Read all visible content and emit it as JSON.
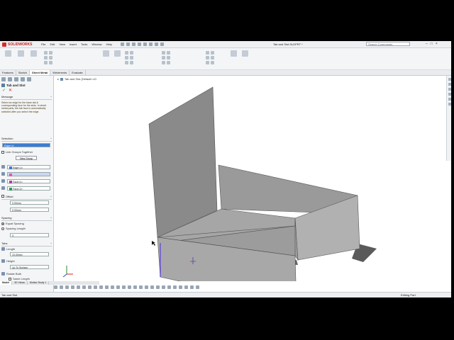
{
  "app": {
    "logo_text": "SOLIDWORKS",
    "document_title": "Tab and Slot.SLDPRT *",
    "search_placeholder": "Search Commands",
    "menus": [
      "File",
      "Edit",
      "View",
      "Insert",
      "Tools",
      "Window",
      "Help"
    ]
  },
  "tabs": [
    "Features",
    "Sketch",
    "Sheet Metal",
    "Weldments",
    "Evaluate"
  ],
  "active_tab": "Sheet Metal",
  "feature_tree_item": "Tab and Slot (Default<<D",
  "panel": {
    "title": "Tab and Slot",
    "message_header": "Message",
    "message_text": "Select an edge for the base tab & corresponding face for the slots. In sheet metal parts, the tab face is automatically selected after you select the edge.",
    "selection_header": "Selection",
    "edge_field": "Edge<1>",
    "link_groups_label": "Link Groups Together",
    "new_group_button": "New Group",
    "sel_items": [
      "Edge<1>",
      "",
      "Face<1>",
      "Face<2>"
    ],
    "offset_header": "Offset",
    "offset_start": "0.00mm",
    "offset_end": "0.00mm",
    "spacing_header": "Spacing",
    "equal_spacing_label": "Equal Spacing",
    "spacing_length_label": "Spacing Length",
    "spacing_value": "3",
    "tabs_header": "Tabs",
    "length_label": "Length",
    "length_value": "10.00mm",
    "height_label": "Height",
    "height_value": "Up To Surface",
    "rotate_label": "Rotate Both",
    "same_label": "Same Length"
  },
  "bottom_tabs": [
    "Model",
    "3D Views",
    "Motion Study 1"
  ],
  "status": {
    "left": "Tab and Slot",
    "right": "Editing Part"
  },
  "colors": {
    "accent_blue": "#3a7bd5",
    "logo_red": "#d52a2a",
    "model_gray": "#9e9e9e",
    "ok_green": "#2b9a2b",
    "cancel_red": "#cc2222"
  }
}
